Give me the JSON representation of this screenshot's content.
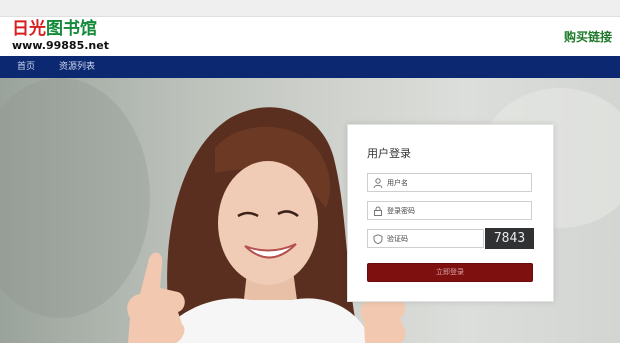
{
  "header": {
    "logo_cn_part1": "日光",
    "logo_cn_part2": "图书馆",
    "logo_url": "www.99885.net",
    "buy_link": "购买链接"
  },
  "nav": {
    "items": [
      {
        "label": "首页"
      },
      {
        "label": "资源列表"
      }
    ]
  },
  "login": {
    "title": "用户登录",
    "username_placeholder": "用户名",
    "password_placeholder": "登录密码",
    "captcha_placeholder": "验证码",
    "captcha_code": "7843",
    "submit_label": "立即登录"
  },
  "colors": {
    "nav_bg": "#0b2870",
    "logo_red": "#d61f1f",
    "logo_green": "#138a3a",
    "buy_link": "#1e7a2a",
    "login_button": "#7f1010"
  },
  "icons": {
    "username": "user-icon",
    "password": "lock-icon",
    "captcha": "shield-icon"
  }
}
